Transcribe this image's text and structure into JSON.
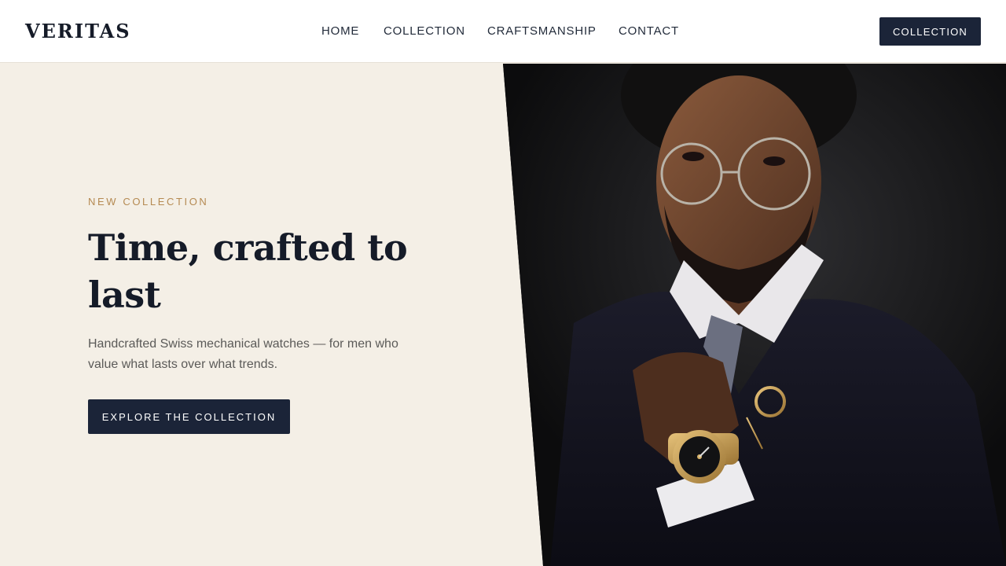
{
  "brand": {
    "name": "VERITAS"
  },
  "nav": {
    "items": [
      "HOME",
      "COLLECTION",
      "CRAFTSMANSHIP",
      "CONTACT"
    ],
    "cta_label": "COLLECTION"
  },
  "hero": {
    "eyebrow": "NEW COLLECTION",
    "headline": "Time, crafted to last",
    "subtext": "Handcrafted Swiss mechanical watches — for men who value what lasts over what trends.",
    "cta_label": "EXPLORE THE COLLECTION",
    "image_subject": "Man in dark suit and round glasses adjusting tie, wearing gold wristwatch"
  },
  "colors": {
    "navy": "#1b2438",
    "cream_background": "#f4efe6",
    "gold_accent": "#b58a52",
    "white": "#ffffff"
  }
}
